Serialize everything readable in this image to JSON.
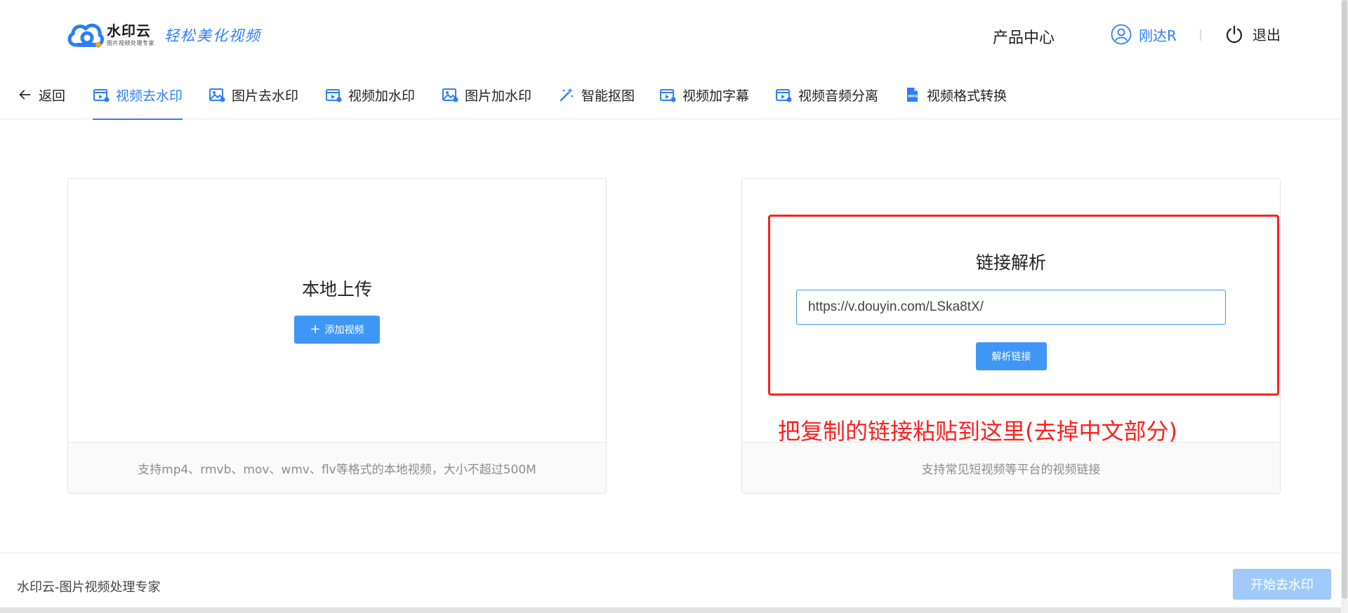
{
  "header": {
    "logo_name": "水印云",
    "logo_sub": "图片视频处理专家",
    "slogan": "轻松美化视频",
    "product_center": "产品中心",
    "username": "刚达R",
    "logout": "退出"
  },
  "tabs": [
    {
      "label": "返回",
      "icon": "arrow-left-icon"
    },
    {
      "label": "视频去水印",
      "icon": "video-icon",
      "active": true
    },
    {
      "label": "图片去水印",
      "icon": "image-icon"
    },
    {
      "label": "视频加水印",
      "icon": "video-add-icon"
    },
    {
      "label": "图片加水印",
      "icon": "image-add-icon"
    },
    {
      "label": "智能抠图",
      "icon": "magic-wand-icon"
    },
    {
      "label": "视频加字幕",
      "icon": "video-subtitle-icon"
    },
    {
      "label": "视频音频分离",
      "icon": "video-audio-icon"
    },
    {
      "label": "视频格式转换",
      "icon": "mp4-file-icon"
    }
  ],
  "local_upload": {
    "title": "本地上传",
    "button": "添加视频",
    "footer": "支持mp4、rmvb、mov、wmv、flv等格式的本地视频，大小不超过500M"
  },
  "link_parse": {
    "title": "链接解析",
    "input_value": "https://v.douyin.com/LSka8tX/",
    "button": "解析链接",
    "footer": "支持常见短视频等平台的视频链接"
  },
  "annotation": "把复制的链接粘贴到这里(去掉中文部分)",
  "bottom": {
    "text": "水印云-图片视频处理专家",
    "start_button": "开始去水印"
  },
  "colors": {
    "accent": "#2c7ef8",
    "button": "#3f97f5",
    "button_disabled": "#9fcaf9",
    "annotation_red": "#ff1f1f"
  }
}
